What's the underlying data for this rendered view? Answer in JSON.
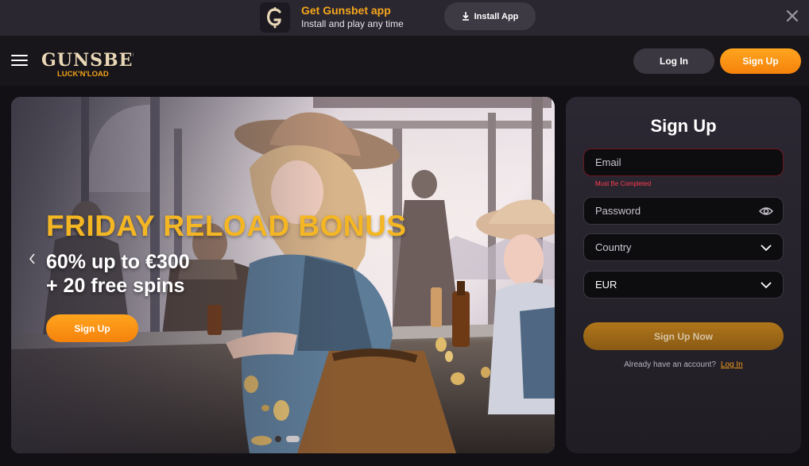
{
  "app_banner": {
    "title": "Get Gunsbet app",
    "subtitle": "Install and play any time",
    "install_label": "Install App",
    "logo_letter": "G"
  },
  "header": {
    "brand_top": "GUNSBET",
    "brand_bottom": "LUCK'N'LOAD",
    "login_label": "Log In",
    "signup_label": "Sign Up"
  },
  "hero": {
    "title": "FRIDAY RELOAD BONUS",
    "line1": "60% up to €300",
    "line2": "+ 20 free spins",
    "cta_label": "Sign Up",
    "slides": 2,
    "active_slide": 2
  },
  "signup": {
    "title": "Sign Up",
    "email_placeholder": "Email",
    "email_error": "Must Be Completed",
    "password_placeholder": "Password",
    "country_placeholder": "Country",
    "currency_value": "EUR",
    "submit_label": "Sign Up Now",
    "already_text": "Already have an account?",
    "login_link": "Log In"
  },
  "colors": {
    "accent_orange": "#f7a61c",
    "hero_title": "#f4b623",
    "error_red": "#ff3b4e",
    "panel_bg": "#2c2833"
  },
  "icons": {
    "download": "download-icon",
    "close": "close-icon",
    "menu": "hamburger-menu-icon",
    "eye": "eye-icon",
    "chevron": "chevron-down-icon",
    "prev": "chevron-left-icon"
  }
}
